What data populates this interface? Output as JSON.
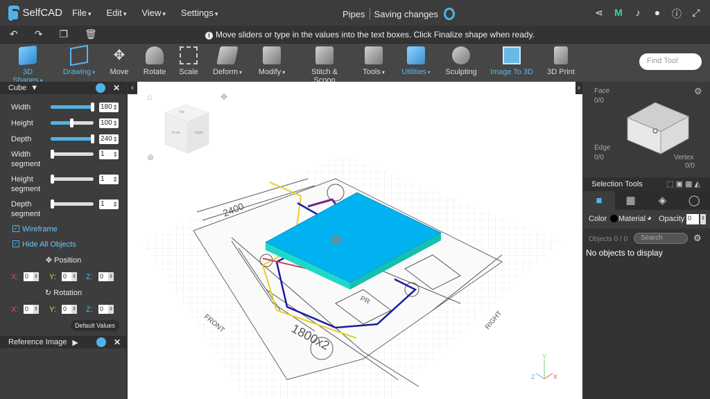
{
  "app": {
    "name": "SelfCAD",
    "project": "Pipes",
    "save_status": "Saving changes"
  },
  "menu": [
    "File",
    "Edit",
    "View",
    "Settings"
  ],
  "top_icons": [
    "share-icon",
    "m-logo-icon",
    "bell-icon",
    "user-icon",
    "info-icon",
    "fullscreen-icon"
  ],
  "hint": "Move sliders or type in the values into the text boxes. Click Finalize shape when ready.",
  "toolbar": {
    "tools": [
      {
        "label": "3D Shapes",
        "icon": "cube-icon",
        "active": true,
        "dropdown": true
      },
      {
        "label": "Drawing",
        "icon": "drawing-icon",
        "active": true,
        "dropdown": true
      },
      {
        "label": "Move",
        "icon": "move-icon"
      },
      {
        "label": "Rotate",
        "icon": "rotate-icon"
      },
      {
        "label": "Scale",
        "icon": "scale-icon"
      },
      {
        "label": "Deform",
        "icon": "deform-icon",
        "dropdown": true
      },
      {
        "label": "Modify",
        "icon": "modify-icon",
        "dropdown": true
      },
      {
        "label": "Stitch & Scoop",
        "icon": "stitch-icon"
      },
      {
        "label": "Tools",
        "icon": "tools-icon",
        "dropdown": true
      },
      {
        "label": "Utilities",
        "icon": "utilities-icon",
        "active": true,
        "dropdown": true
      },
      {
        "label": "Sculpting",
        "icon": "sculpting-icon"
      },
      {
        "label": "Image To 3D",
        "icon": "image-to-3d-icon",
        "active": true
      },
      {
        "label": "3D Print",
        "icon": "print-icon"
      }
    ],
    "find_placeholder": "Find Tool"
  },
  "left_panel": {
    "title": "Cube",
    "params": [
      {
        "label": "Width",
        "value": "180",
        "fraction": 1.0
      },
      {
        "label": "Height",
        "value": "100",
        "fraction": 0.5
      },
      {
        "label": "Depth",
        "value": "240",
        "fraction": 1.0
      },
      {
        "label": "Width segment",
        "value": "1",
        "fraction": 0
      },
      {
        "label": "Height segment",
        "value": "1",
        "fraction": 0
      },
      {
        "label": "Depth segment",
        "value": "1",
        "fraction": 0
      }
    ],
    "wireframe": "Wireframe",
    "hide_all": "Hide All Objects",
    "position_label": "Position",
    "rotation_label": "Rotation",
    "axis": {
      "x": "X:",
      "y": "Y:",
      "z": "Z:"
    },
    "position": {
      "x": "0",
      "y": "0",
      "z": "0"
    },
    "rotation": {
      "x": "0",
      "y": "0",
      "z": "0"
    },
    "default_values": "Default Values",
    "reference_image": "Reference Image"
  },
  "viewport": {
    "cube_faces": [
      "Top",
      "Front",
      "Right"
    ],
    "drawing_labels": [
      "2400",
      "1800x2",
      "PR",
      "FRONT",
      "RIGHT"
    ],
    "axes": {
      "x": "X",
      "y": "Y",
      "z": "Z"
    },
    "colors": {
      "box_top": "#00b3f0",
      "box_side": "#1ed8c8",
      "pipe_blue": "#1a1aa0",
      "pipe_purple": "#6a2a8a",
      "pipe_yellow": "#e8d020"
    }
  },
  "right_panel": {
    "face_label": "Face",
    "face_count": "0/0",
    "edge_label": "Edge",
    "edge_count": "0/0",
    "vertex_label": "Vertex",
    "vertex_count": "0/0",
    "selection_tools": "Selection Tools",
    "color": "Color",
    "material": "Material",
    "opacity": "Opacity",
    "opacity_value": "0",
    "objects_count": "Objects 0 / 0",
    "search_placeholder": "Search",
    "no_objects": "No objects to display"
  }
}
